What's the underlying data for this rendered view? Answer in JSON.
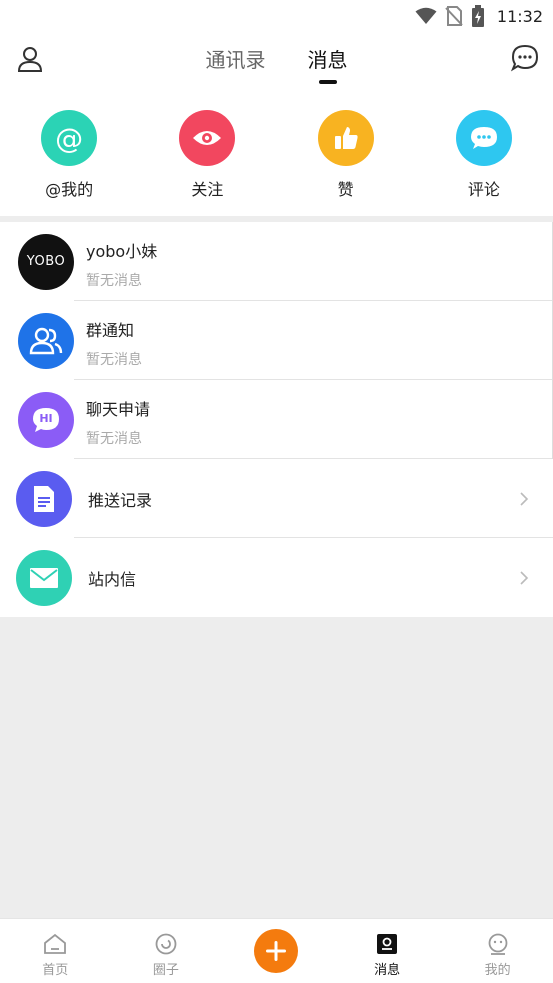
{
  "status_bar": {
    "time": "11:32"
  },
  "header": {
    "tabs": [
      {
        "label": "通讯录",
        "active": false
      },
      {
        "label": "消息",
        "active": true
      }
    ]
  },
  "quick_actions": [
    {
      "label": "@我的",
      "icon": "at-icon",
      "color": "#2bd3b5"
    },
    {
      "label": "关注",
      "icon": "eye-icon",
      "color": "#f2475f"
    },
    {
      "label": "赞",
      "icon": "thumb-up-icon",
      "color": "#f8b321"
    },
    {
      "label": "评论",
      "icon": "comment-icon",
      "color": "#2ec7f0"
    }
  ],
  "messages": [
    {
      "title": "yobo小妹",
      "subtitle": "暂无消息",
      "avatar_text": "YOBO"
    },
    {
      "title": "群通知",
      "subtitle": "暂无消息"
    },
    {
      "title": "聊天申请",
      "subtitle": "暂无消息",
      "avatar_text": "HI"
    }
  ],
  "links": [
    {
      "title": "推送记录"
    },
    {
      "title": "站内信"
    }
  ],
  "bottom_nav": [
    {
      "label": "首页",
      "icon": "home-icon",
      "active": false
    },
    {
      "label": "圈子",
      "icon": "circle-icon",
      "active": false
    },
    {
      "label": "",
      "icon": "plus-icon",
      "active": false
    },
    {
      "label": "消息",
      "icon": "message-icon",
      "active": true
    },
    {
      "label": "我的",
      "icon": "profile-icon",
      "active": false
    }
  ],
  "colors": {
    "accent": "#f47b0e"
  }
}
